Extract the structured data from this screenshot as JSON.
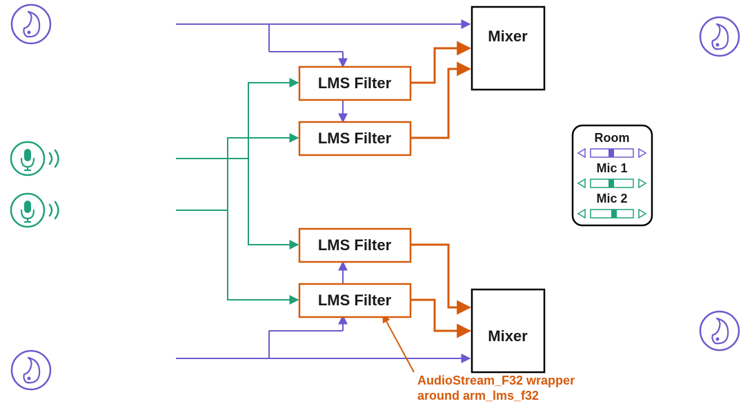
{
  "filters": {
    "f1": "LMS Filter",
    "f2": "LMS Filter",
    "f3": "LMS Filter",
    "f4": "LMS Filter"
  },
  "mixers": {
    "top": "Mixer",
    "bottom": "Mixer"
  },
  "annotation": {
    "line1": "AudioStream_F32 wrapper",
    "line2": "around arm_lms_f32"
  },
  "panel": {
    "room": "Room",
    "mic1": "Mic 1",
    "mic2": "Mic 2"
  },
  "colors": {
    "purple": "#6a5acd",
    "green": "#1fa07a",
    "orange": "#d65a0b",
    "black": "#000000",
    "white": "#ffffff"
  }
}
